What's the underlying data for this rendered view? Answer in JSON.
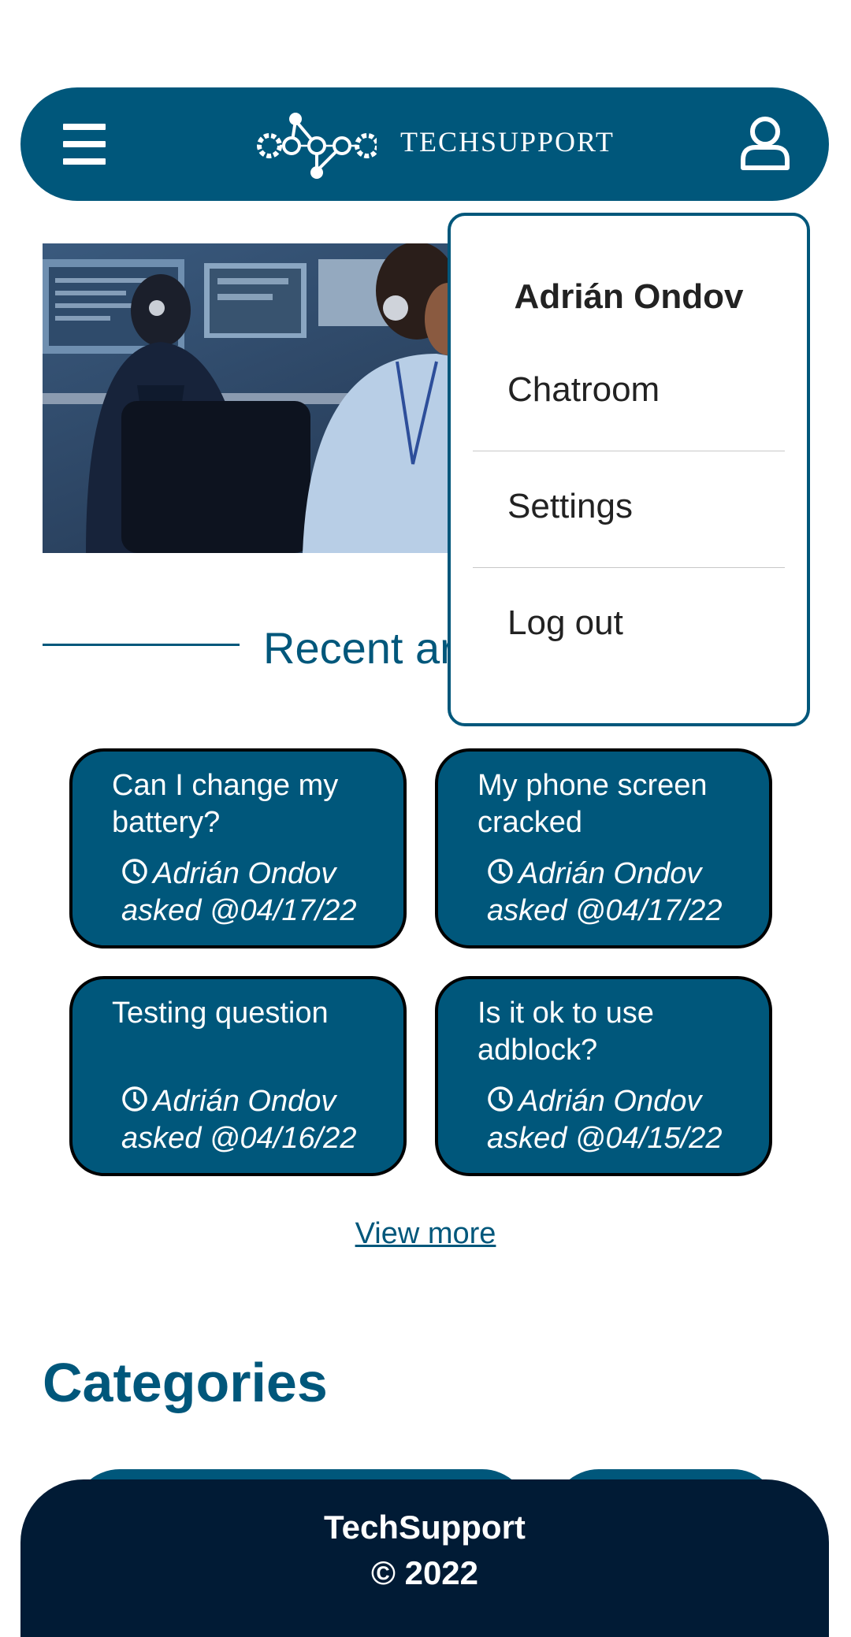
{
  "header": {
    "brand": "TECHSUPPORT",
    "menu_icon": "hamburger-icon",
    "user_icon": "user-icon"
  },
  "colors": {
    "primary": "#00577b",
    "footer": "#011b35",
    "card_border": "#000000",
    "background": "#ffffff"
  },
  "hero": {
    "image": "photo of support agents with headsets at computer monitors"
  },
  "recent": {
    "title_visible": "Recent ar",
    "questions": [
      {
        "question": "Can I change my battery?",
        "meta": "Adrián Ondov asked @04/17/22"
      },
      {
        "question": "My phone screen cracked",
        "meta": "Adrián Ondov asked @04/17/22"
      },
      {
        "question": "Testing question",
        "meta": "Adrián Ondov asked @04/16/22"
      },
      {
        "question": "Is it ok to use adblock?",
        "meta": "Adrián Ondov asked @04/15/22"
      }
    ],
    "view_more": "View more"
  },
  "categories": {
    "title": "Categories"
  },
  "footer": {
    "name": "TechSupport",
    "copyright": "© 2022"
  },
  "dropdown": {
    "user_name": "Adrián Ondov",
    "items": [
      {
        "label": "Chatroom"
      },
      {
        "label": "Settings"
      },
      {
        "label": "Log out"
      }
    ]
  }
}
